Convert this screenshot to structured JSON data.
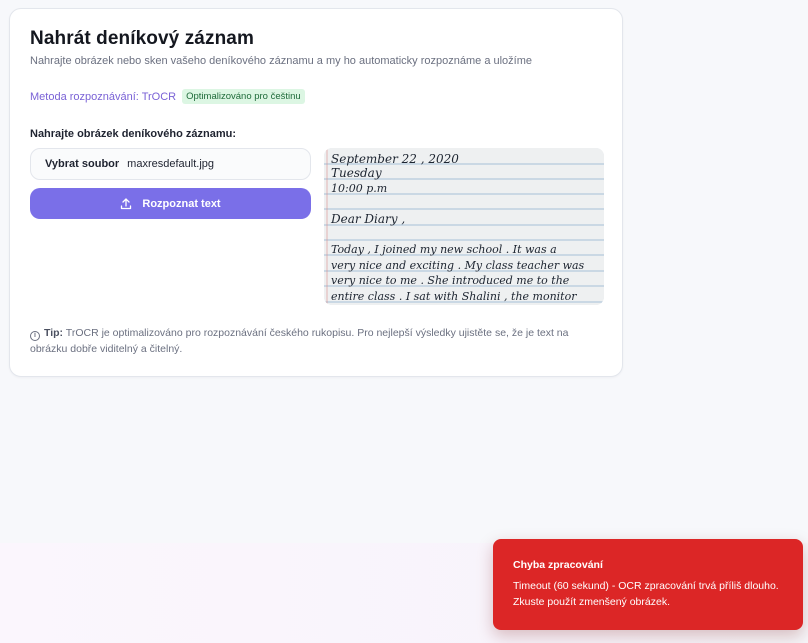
{
  "header": {
    "title": "Nahrát deníkový záznam",
    "subtitle": "Nahrajte obrázek nebo sken vašeho deníkového záznamu a my ho automaticky rozpoznáme a uložíme"
  },
  "method": {
    "label": "Metoda rozpoznávání: TrOCR",
    "badge": "Optimalizováno pro češtinu"
  },
  "upload": {
    "label": "Nahrajte obrázek deníkového záznamu:",
    "choose_button": "Vybrat soubor",
    "file_name": "maxresdefault.jpg",
    "submit_label": "Rozpoznat text",
    "submit_icon": "upload-icon"
  },
  "preview": {
    "lines": [
      "September  22 , 2020",
      "Tuesday",
      "10:00 p.m",
      "Dear  Diary ,",
      "Today ,  I  joined  my  new  school . It  was  a",
      "very   nice    and   exciting .  My  class  teacher  was",
      "very    nice   to   me .  She   introduced   me  to  the",
      "entire   class .   I   sat   with   Shalini ,  the  monitor"
    ]
  },
  "tip": {
    "icon": "info-icon",
    "label": "Tip:",
    "text": "TrOCR je optimalizováno pro rozpoznávání českého rukopisu. Pro nejlepší výsledky ujistěte se, že je text na obrázku dobře viditelný a čitelný."
  },
  "toast": {
    "title": "Chyba zpracování",
    "message": "Timeout (60 sekund) - OCR zpracování trvá příliš dlouho. Zkuste použít zmenšený obrázek."
  },
  "colors": {
    "accent": "#7a6fe8",
    "error": "#dc2626",
    "badge_bg": "#dcf6e3"
  }
}
